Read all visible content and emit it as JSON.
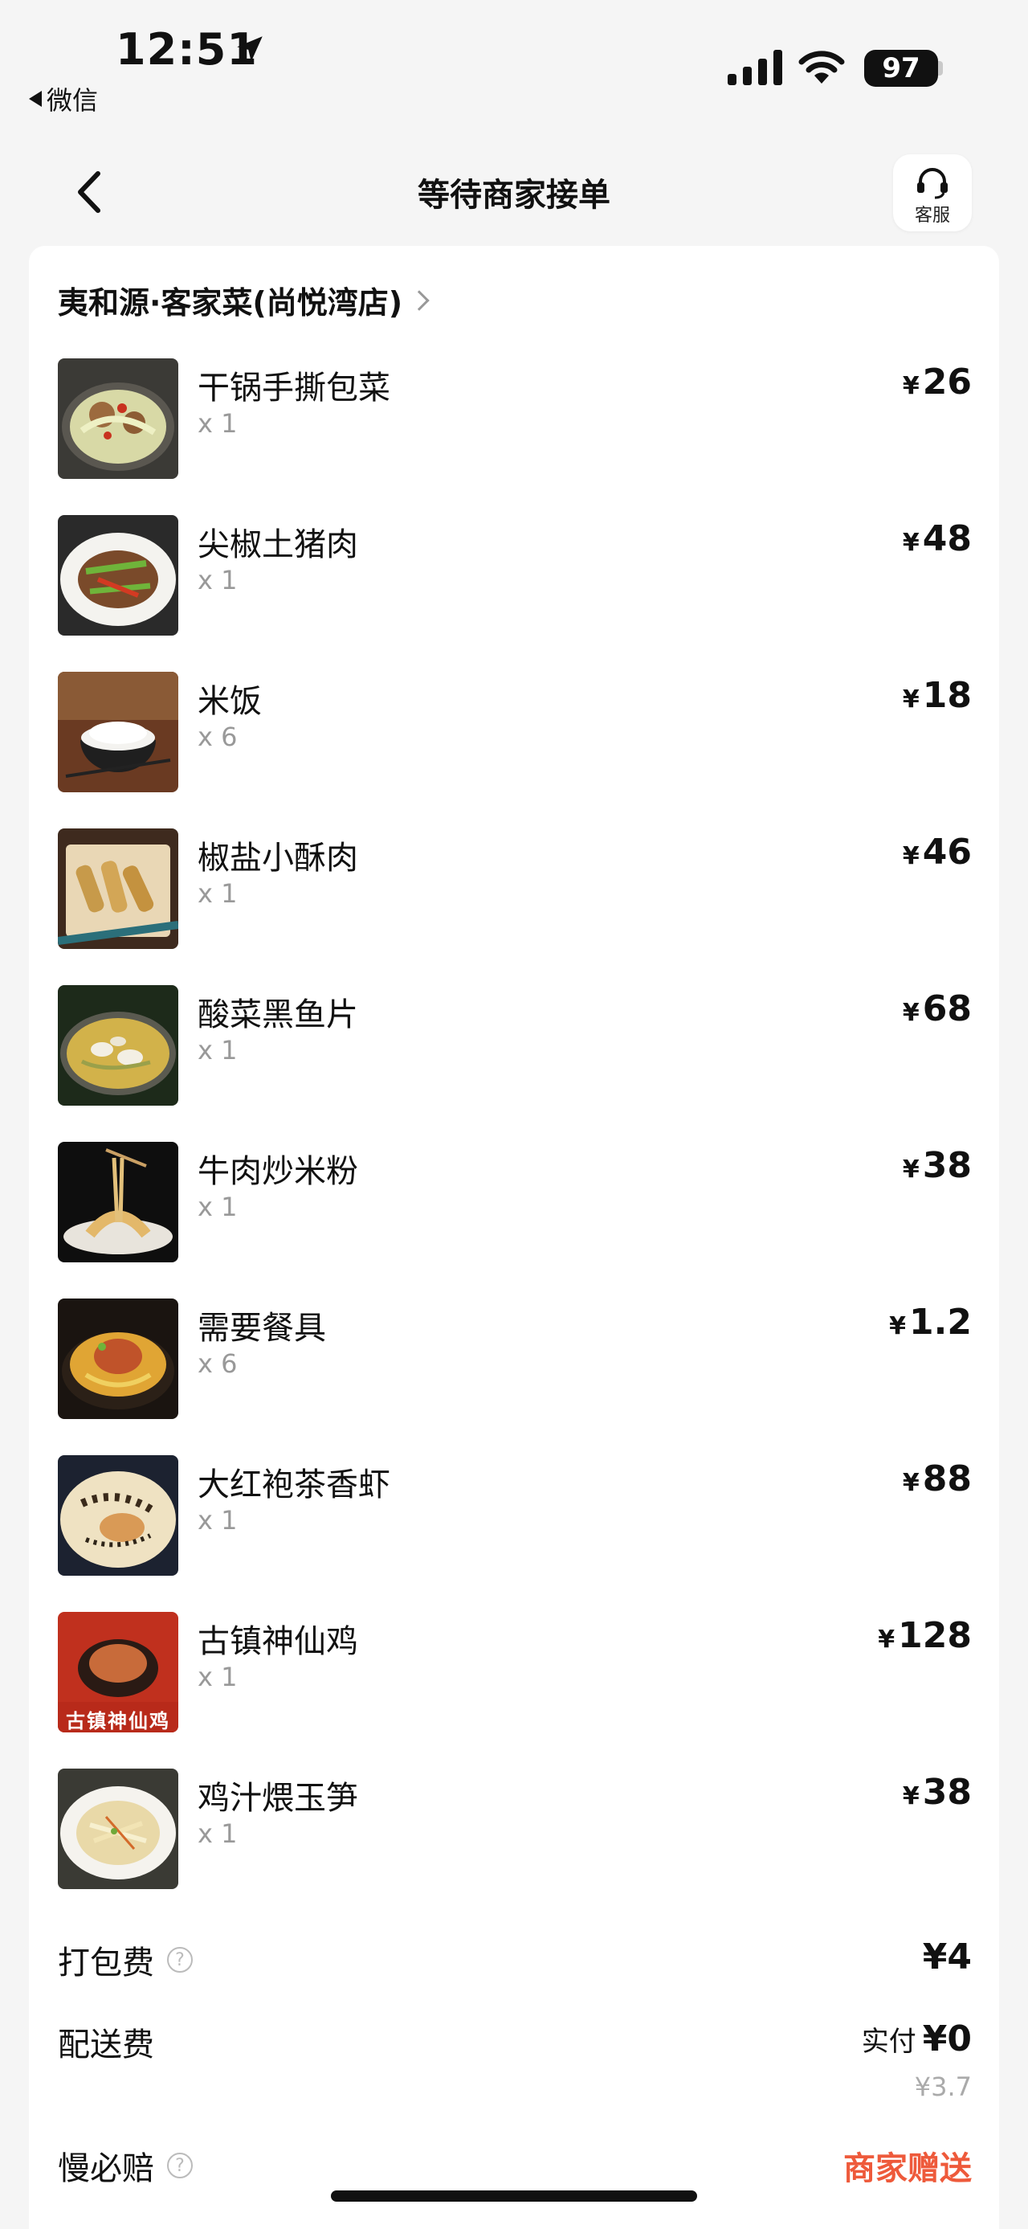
{
  "status_bar": {
    "time": "12:51",
    "back_app": "微信",
    "battery": "97"
  },
  "nav": {
    "title": "等待商家接单",
    "customer_service": "客服"
  },
  "store": {
    "name": "夷和源·客家菜(尚悦湾店)"
  },
  "currency": "¥",
  "items": [
    {
      "name": "干锅手撕包菜",
      "qty": "x 1",
      "price": "26",
      "thumb": "cabbage-dish"
    },
    {
      "name": "尖椒土猪肉",
      "qty": "x 1",
      "price": "48",
      "thumb": "pepper-pork-dish"
    },
    {
      "name": "米饭",
      "qty": "x 6",
      "price": "18",
      "thumb": "rice-bowl"
    },
    {
      "name": "椒盐小酥肉",
      "qty": "x 1",
      "price": "46",
      "thumb": "fried-pork-dish"
    },
    {
      "name": "酸菜黑鱼片",
      "qty": "x 1",
      "price": "68",
      "thumb": "fish-soup"
    },
    {
      "name": "牛肉炒米粉",
      "qty": "x 1",
      "price": "38",
      "thumb": "beef-noodles"
    },
    {
      "name": "需要餐具",
      "qty": "x 6",
      "price": "1.2",
      "thumb": "claypot-chicken"
    },
    {
      "name": "大红袍茶香虾",
      "qty": "x 1",
      "price": "88",
      "thumb": "tea-shrimp"
    },
    {
      "name": "古镇神仙鸡",
      "qty": "x 1",
      "price": "128",
      "thumb": "immortal-chicken"
    },
    {
      "name": "鸡汁煨玉笋",
      "qty": "x 1",
      "price": "38",
      "thumb": "bamboo-shoot-soup"
    }
  ],
  "thumb_text": {
    "immortal_chicken_banner": "古镇神仙鸡"
  },
  "fees": {
    "packing": {
      "label": "打包费",
      "value": "¥4"
    },
    "delivery": {
      "label": "配送费",
      "prefix": "实付",
      "value": "¥0",
      "original": "¥3.7"
    },
    "slow_compensation": {
      "label": "慢必赔",
      "value": "商家赠送"
    }
  },
  "colors": {
    "accent": "#ee5a3b",
    "background": "#f5f5f5"
  }
}
